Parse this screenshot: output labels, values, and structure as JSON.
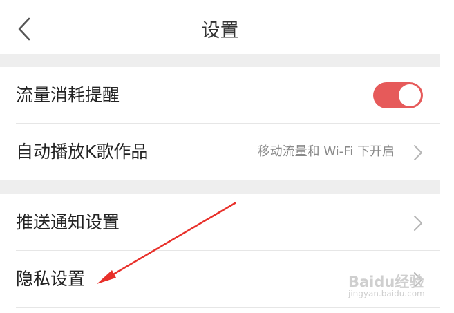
{
  "header": {
    "title": "设置"
  },
  "settings": {
    "data_usage_alert": {
      "label": "流量消耗提醒",
      "toggle_on": true
    },
    "autoplay": {
      "label": "自动播放K歌作品",
      "value": "移动流量和 Wi-Fi 下开启"
    },
    "push": {
      "label": "推送通知设置"
    },
    "privacy": {
      "label": "隐私设置"
    }
  },
  "watermark": {
    "brand": "Baidu经验",
    "domain": "jingyan.baidu.com"
  },
  "colors": {
    "accent": "#e65a5a",
    "annotation": "#e8302a",
    "section_gap": "#eeeeee"
  }
}
